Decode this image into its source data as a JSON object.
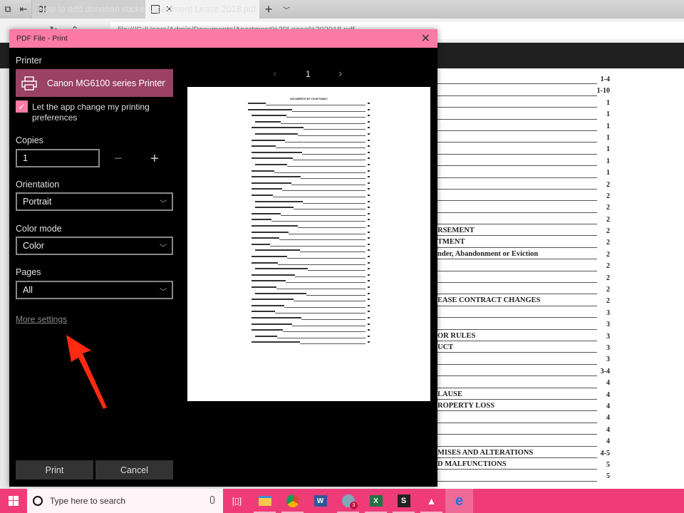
{
  "browser": {
    "tabs": [
      {
        "label": "How to add donation sticke",
        "favicon": "BI",
        "active": false
      },
      {
        "label": "Apartment Lease 2018.pdf",
        "favicon": "pdf-icon",
        "active": true
      }
    ],
    "address_blurred": "file:///C:/Users/Admin/Documents/Apartment%20Lease%202018.pdf"
  },
  "dialog": {
    "title": "PDF File - Print",
    "printer_label": "Printer",
    "printer_value": "Canon MG6100 series Printer",
    "checkbox_label": "Let the app change my printing preferences",
    "checkbox_checked": true,
    "copies_label": "Copies",
    "copies_value": "1",
    "orientation_label": "Orientation",
    "orientation_value": "Portrait",
    "color_label": "Color mode",
    "color_value": "Color",
    "pages_label": "Pages",
    "pages_value": "All",
    "more_settings": "More settings",
    "print_button": "Print",
    "cancel_button": "Cancel",
    "preview_page": "1",
    "accent": "#fd7aa7"
  },
  "document_toc": [
    {
      "text": "",
      "page": "1-4"
    },
    {
      "text": "",
      "page": "1-10"
    },
    {
      "text": "",
      "page": "1"
    },
    {
      "text": "",
      "page": "1"
    },
    {
      "text": "",
      "page": "1"
    },
    {
      "text": "",
      "page": "1"
    },
    {
      "text": "",
      "page": "1"
    },
    {
      "text": "",
      "page": "1"
    },
    {
      "text": "",
      "page": "1"
    },
    {
      "text": "",
      "page": "2"
    },
    {
      "text": "",
      "page": "2"
    },
    {
      "text": "",
      "page": "2"
    },
    {
      "text": "",
      "page": "2"
    },
    {
      "text": "RSEMENT",
      "page": "2"
    },
    {
      "text": "TMENT",
      "page": "2"
    },
    {
      "text": "nder, Abandonment or Eviction",
      "page": "2"
    },
    {
      "text": "",
      "page": "2"
    },
    {
      "text": "",
      "page": "2"
    },
    {
      "text": "",
      "page": "2"
    },
    {
      "text": "EASE CONTRACT CHANGES",
      "page": "2"
    },
    {
      "text": "",
      "page": "3"
    },
    {
      "text": "",
      "page": "3"
    },
    {
      "text": "OR RULES",
      "page": "3"
    },
    {
      "text": "UCT",
      "page": "3"
    },
    {
      "text": "",
      "page": "3"
    },
    {
      "text": "",
      "page": "3-4"
    },
    {
      "text": "",
      "page": "4"
    },
    {
      "text": "LAUSE",
      "page": "4"
    },
    {
      "text": "ROPERTY LOSS",
      "page": "4"
    },
    {
      "text": "",
      "page": "4"
    },
    {
      "text": "",
      "page": "4"
    },
    {
      "text": "",
      "page": "4"
    },
    {
      "text": "MISES AND ALTERATIONS",
      "page": "4-5"
    },
    {
      "text": "D MALFUNCTIONS",
      "page": "5"
    },
    {
      "text": "",
      "page": "5"
    }
  ],
  "taskbar": {
    "search_placeholder": "Type here to search",
    "apps": [
      "task-view",
      "file-explorer",
      "chrome",
      "word",
      "app-badge",
      "excel",
      "app-s",
      "photos",
      "edge"
    ],
    "badge_count": "3"
  },
  "annotation": {
    "arrow_color": "#ff2a10",
    "points_to": "More settings"
  }
}
